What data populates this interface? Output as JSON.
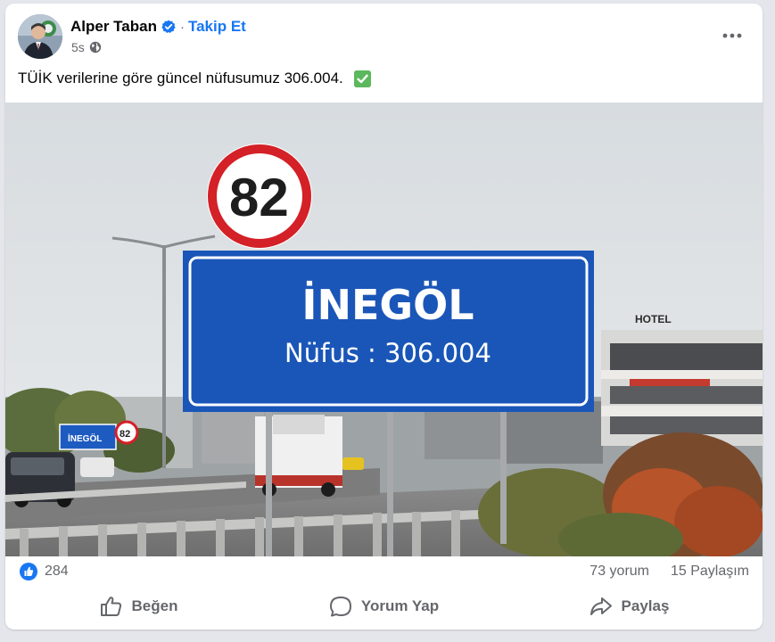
{
  "post": {
    "author": "Alper Taban",
    "separator": "·",
    "follow_label": "Takip Et",
    "time": "5s",
    "text": "TÜİK verilerine göre güncel nüfusumuz 306.004.",
    "icons": {
      "verified": "verified-badge-icon",
      "privacy": "globe-icon",
      "more": "more-dots-icon",
      "text_emoji": "check-mark-emoji"
    }
  },
  "image": {
    "speed_sign": "82",
    "city_sign_name": "İNEGÖL",
    "city_sign_population": "Nüfus : 306.004",
    "hotel_sign": "HOTEL",
    "small_city_sign": "İNEGÖL",
    "small_speed_sign": "82"
  },
  "stats": {
    "likes": "284",
    "comments": "73 yorum",
    "shares": "15 Paylaşım"
  },
  "actions": {
    "like_label": "Beğen",
    "comment_label": "Yorum Yap",
    "share_label": "Paylaş"
  },
  "colors": {
    "accent": "#1877f2",
    "sign_blue": "#1a56b8",
    "speed_ring": "#d42027",
    "secondary_text": "#65676b"
  }
}
